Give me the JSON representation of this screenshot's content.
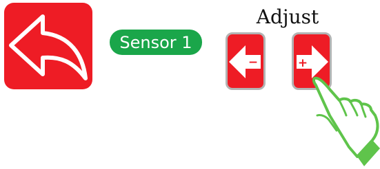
{
  "colors": {
    "accent_red": "#ee1c25",
    "badge_green": "#1aa64a",
    "hand_green": "#5fc44b",
    "button_border": "#b3b3b3"
  },
  "back_button": {
    "icon": "undo-arrow-icon"
  },
  "sensor": {
    "label": "Sensor 1"
  },
  "adjust": {
    "title": "Adjust",
    "minus_sign": "−",
    "plus_sign": "+",
    "minus_icon": "left-arrow-icon",
    "plus_icon": "right-arrow-icon"
  },
  "pointer": {
    "icon": "pointing-hand-icon"
  }
}
